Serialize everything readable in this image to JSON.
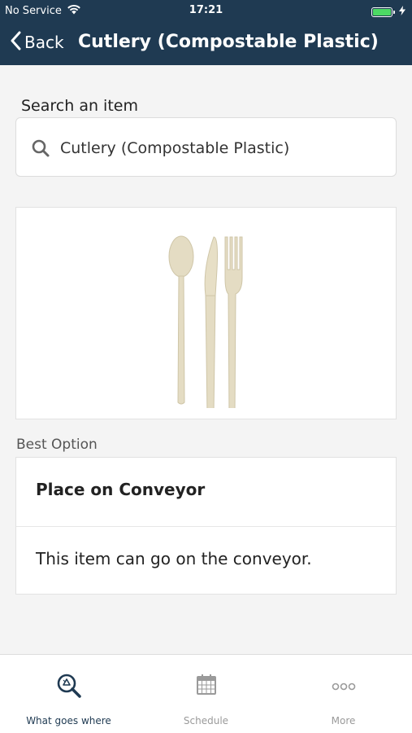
{
  "status_bar": {
    "carrier": "No Service",
    "time": "17:21"
  },
  "nav": {
    "back_label": "Back",
    "title": "Cutlery (Compostable Plastic)"
  },
  "search": {
    "label": "Search an item",
    "value": "Cutlery (Compostable Plastic)"
  },
  "item_image": {
    "icon": "cutlery-image"
  },
  "best_option": {
    "section_label": "Best Option",
    "title": "Place on Conveyor",
    "description": "This item can go on the conveyor."
  },
  "tabs": [
    {
      "label": "What goes where",
      "icon": "recycle-search-icon",
      "active": true
    },
    {
      "label": "Schedule",
      "icon": "calendar-icon",
      "active": false
    },
    {
      "label": "More",
      "icon": "more-icon",
      "active": false
    }
  ],
  "colors": {
    "header_bg": "#1f3a52",
    "active_tab": "#1f3a52",
    "inactive_tab": "#9a9a9a",
    "battery": "#4cd964"
  }
}
